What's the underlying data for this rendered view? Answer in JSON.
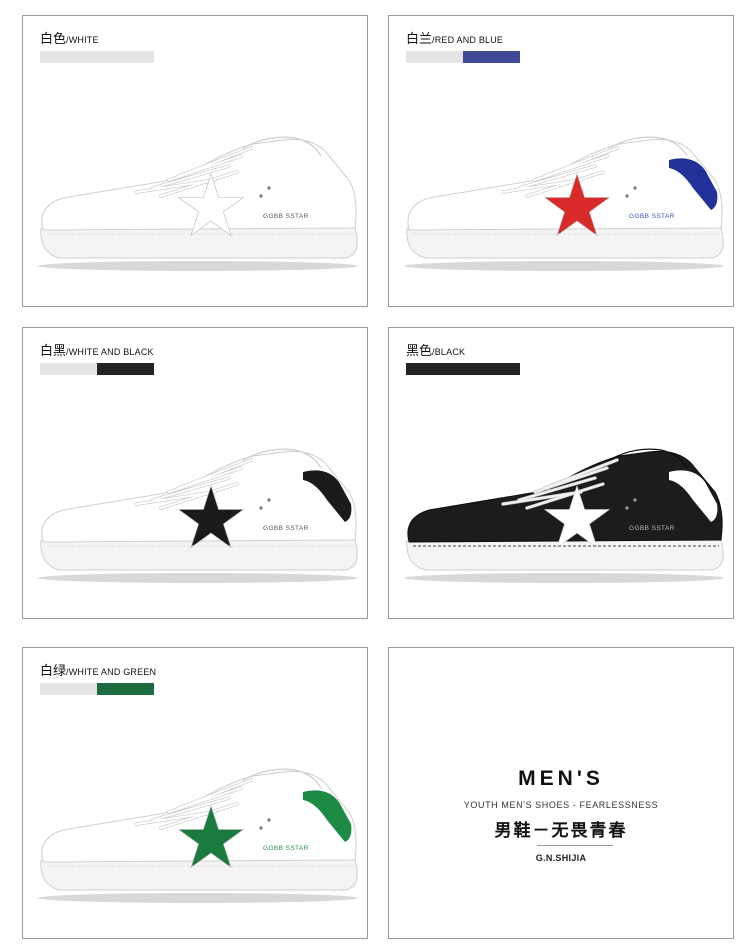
{
  "variants": [
    {
      "zh": "白色",
      "en": "/WHITE",
      "swatch": [
        "#e4e4e6",
        "#e4e4e6"
      ],
      "star": "#ffffff",
      "body": "#ffffff",
      "heel": "#ffffff",
      "logo": "GGBB SSTAR",
      "logo_color": "#555555"
    },
    {
      "zh": "白兰",
      "en": "/RED AND BLUE",
      "swatch": [
        "#e4e4e6",
        "#3e4894"
      ],
      "star": "#d92a2a",
      "body": "#ffffff",
      "heel": "#22309a",
      "logo": "GGBB SSTAR",
      "logo_color": "#3a55b8"
    },
    {
      "zh": "白黑",
      "en": "/WHITE AND BLACK",
      "swatch": [
        "#e4e4e6",
        "#232326"
      ],
      "star": "#1b1b1d",
      "body": "#ffffff",
      "heel": "#1b1b1d",
      "logo": "GGBB SSTAR",
      "logo_color": "#555555"
    },
    {
      "zh": "黑色",
      "en": "/BLACK",
      "swatch": [
        "#232326",
        "#232326"
      ],
      "star": "#ffffff",
      "body": "#1c1c1e",
      "heel": "#ffffff",
      "logo": "GGBB SSTAR",
      "logo_color": "#bbbbbb"
    },
    {
      "zh": "白绿",
      "en": "/WHITE AND GREEN",
      "swatch": [
        "#e4e4e6",
        "#1b6b3e"
      ],
      "star": "#1b7a3e",
      "body": "#ffffff",
      "heel": "#1d8a45",
      "logo": "GGBB SSTAR",
      "logo_color": "#2f8a4e"
    }
  ],
  "brand": {
    "title": "MEN'S",
    "tagline": "YOUTH MEN'S SHOES - FEARLESSNESS",
    "zh_line": "男鞋－无畏青春",
    "mark": "G.N.SHIJIA"
  }
}
